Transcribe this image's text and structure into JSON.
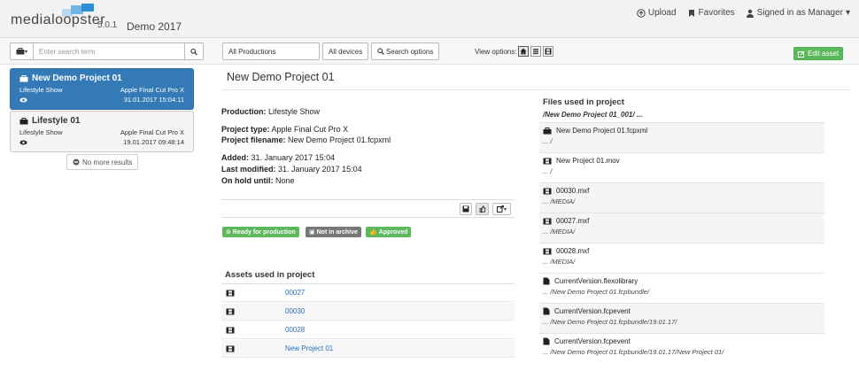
{
  "header": {
    "logo": "medialoopster",
    "version": "5.0.1",
    "instance": "Demo 2017",
    "upload": "Upload",
    "favorites": "Favorites",
    "signed_in": "Signed in as Manager"
  },
  "toolbar": {
    "search_placeholder": "Enter search term",
    "productions": "All Productions",
    "devices": "All devices",
    "search_options": "Search options",
    "view_options": "View options:",
    "edit_asset": "Edit asset"
  },
  "results": [
    {
      "title": "New Demo Project 01",
      "production": "Lifestyle Show",
      "app": "Apple Final Cut Pro X",
      "date": "31.01.2017 15:04:11"
    },
    {
      "title": "Lifestyle 01",
      "production": "Lifestyle Show",
      "app": "Apple Final Cut Pro X",
      "date": "19.01.2017 09:48:14"
    }
  ],
  "no_more": "No more results",
  "detail": {
    "title": "New Demo Project 01",
    "production_label": "Production:",
    "production": "Lifestyle Show",
    "type_label": "Project type:",
    "type": "Apple Final Cut Pro X",
    "filename_label": "Project filename:",
    "filename": "New Demo Project 01.fcpxml",
    "added_label": "Added:",
    "added": "31. January 2017 15:04",
    "modified_label": "Last modified:",
    "modified": "31. January 2017 15:04",
    "hold_label": "On hold until:",
    "hold": "None"
  },
  "badges": {
    "ready": "Ready for production",
    "archive": "Not in archive",
    "approved": "Approved"
  },
  "badge_colors": {
    "ready": "#5cb85c",
    "archive": "#777777",
    "approved": "#5cb85c"
  },
  "assets_title": "Assets used in project",
  "assets": [
    "00027",
    "00030",
    "00028",
    "New Project 01"
  ],
  "files_title": "Files used in project",
  "files_root": "/New Demo Project 01_001/ ...",
  "files": [
    {
      "icon": "briefcase-icon",
      "name": "New Demo Project 01.fcpxml",
      "path": "... /"
    },
    {
      "icon": "film-icon",
      "name": "New Project 01.mov",
      "path": "... /"
    },
    {
      "icon": "film-icon",
      "name": "00030.mxf",
      "path": "... /MEDIA/"
    },
    {
      "icon": "film-icon",
      "name": "00027.mxf",
      "path": "... /MEDIA/"
    },
    {
      "icon": "film-icon",
      "name": "00028.mxf",
      "path": "... /MEDIA/"
    },
    {
      "icon": "file-icon",
      "name": "CurrentVersion.flexolibrary",
      "path": "... /New Demo Project 01.fcpbundle/"
    },
    {
      "icon": "file-icon",
      "name": "CurrentVersion.fcpevent",
      "path": "... /New Demo Project 01.fcpbundle/19.01.17/"
    },
    {
      "icon": "file-icon",
      "name": "CurrentVersion.fcpevent",
      "path": "... /New Demo Project 01.fcpbundle/19.01.17/New Project 01/"
    }
  ]
}
